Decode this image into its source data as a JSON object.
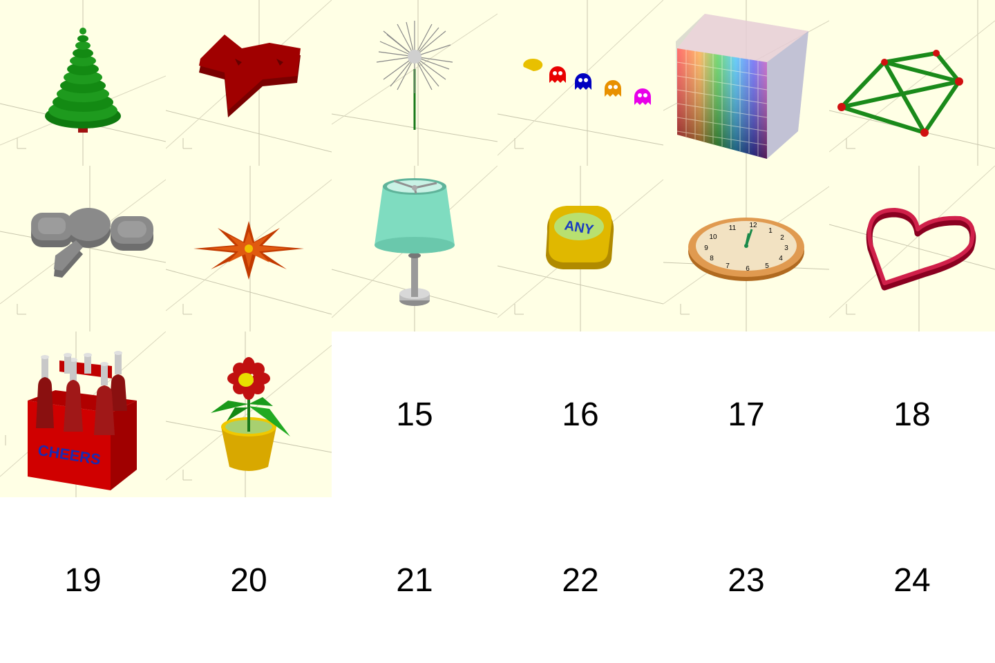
{
  "thumbnails": [
    {
      "id": 1,
      "icon": "christmas-tree"
    },
    {
      "id": 2,
      "icon": "red-star-shape"
    },
    {
      "id": 3,
      "icon": "dandelion-seedhead"
    },
    {
      "id": 4,
      "icon": "pacman-ghosts"
    },
    {
      "id": 5,
      "icon": "color-cube"
    },
    {
      "id": 6,
      "icon": "green-frame-structure"
    },
    {
      "id": 7,
      "icon": "grey-keychain-plate"
    },
    {
      "id": 8,
      "icon": "orange-flower-star"
    },
    {
      "id": 9,
      "icon": "table-lamp"
    },
    {
      "id": 10,
      "icon": "any-key-button",
      "label": "ANY"
    },
    {
      "id": 11,
      "icon": "wall-clock",
      "dial": [
        "12",
        "1",
        "2",
        "3",
        "4",
        "5",
        "6",
        "7",
        "8",
        "9",
        "10",
        "11"
      ]
    },
    {
      "id": 12,
      "icon": "heart-cookie-cutter"
    },
    {
      "id": 13,
      "icon": "beer-six-pack",
      "label": "CHEERS"
    },
    {
      "id": 14,
      "icon": "potted-flower"
    }
  ],
  "placeholders": [
    "15",
    "16",
    "17",
    "18",
    "19",
    "20",
    "21",
    "22",
    "23",
    "24"
  ],
  "colors": {
    "render_background": "#ffffe5",
    "placeholder_background": "#ffffff"
  }
}
